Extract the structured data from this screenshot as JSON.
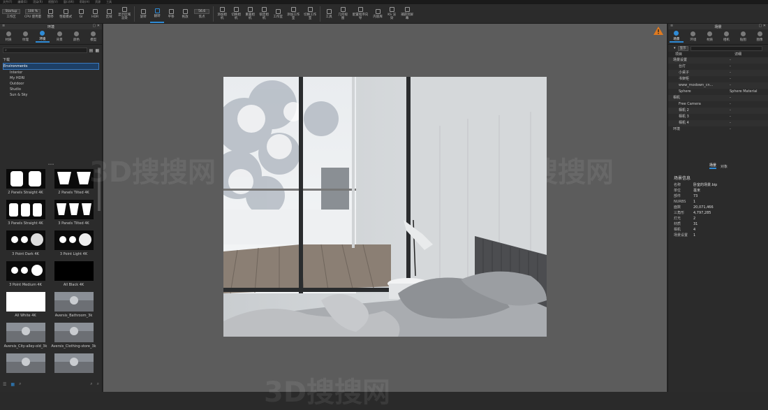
{
  "menu": [
    "文件(F)",
    "编辑(E)",
    "渲染(R)",
    "视图(V)",
    "窗口(W)",
    "帮助(H)",
    "资源",
    "工具"
  ],
  "toolbar": {
    "workspace_select": "Startup",
    "quality_value": "100 %",
    "cpu_label": "CPU 使用量",
    "pause_label": "暂停",
    "perf_label": "性能模式",
    "gi_label": "GI",
    "hdr_label": "HDR",
    "region_label": "区域",
    "region_render_label": "显示区域渲染",
    "rotate_label": "旋转",
    "translate_label": "平移",
    "rotate_view_label": "翻转",
    "drag_label": "拖放",
    "fov_value": "56.6",
    "focus_label": "焦点",
    "add_camera_label": "添加相机",
    "switch_camera_label": "切换相机",
    "reset_camera_label": "重置相机",
    "lock_camera_label": "锁定相机",
    "studio_label": "工作室",
    "add_studio_label": "添加工作室",
    "switch_studio_label": "切换工作室",
    "tools_label": "工具",
    "geometry_label": "几何视图",
    "configurator_label": "配置程序向导",
    "content_label": "内容库",
    "ks_label": "KS 渲染",
    "screenshot_label": "捕获到屏幕"
  },
  "left_panel": {
    "title": "环境",
    "tabs": [
      {
        "label": "材质",
        "icon": "material-icon"
      },
      {
        "label": "纹理",
        "icon": "texture-icon"
      },
      {
        "label": "环境",
        "icon": "environment-icon"
      },
      {
        "label": "背景",
        "icon": "backplate-icon"
      },
      {
        "label": "颜色",
        "icon": "color-icon"
      },
      {
        "label": "模型",
        "icon": "model-icon"
      }
    ],
    "search_placeholder": "",
    "tree": {
      "root": "下载",
      "selected": "Environments",
      "children": [
        "Interior",
        "My HDRI",
        "Outdoor",
        "Studio",
        "Sun & Sky"
      ]
    },
    "thumbnails": [
      {
        "label": "2 Panels Straight 4K",
        "kind": "panels-straight"
      },
      {
        "label": "2 Panels Tilted 4K",
        "kind": "panels-tilted"
      },
      {
        "label": "3 Panels Straight 4K",
        "kind": "panels3-straight"
      },
      {
        "label": "3 Panels Tilted 4K",
        "kind": "panels3-tilted"
      },
      {
        "label": "3 Point Dark 4K",
        "kind": "point-dark"
      },
      {
        "label": "3 Point Light 4K",
        "kind": "point-light"
      },
      {
        "label": "3 Point Medium 4K",
        "kind": "point-medium"
      },
      {
        "label": "All Black 4K",
        "kind": "black"
      },
      {
        "label": "All White 4K",
        "kind": "white"
      },
      {
        "label": "Aversis_Bathroom_3k",
        "kind": "photo"
      },
      {
        "label": "Aversis_City-alley-old_3k",
        "kind": "photo"
      },
      {
        "label": "Aversis_Clothing-store_3k",
        "kind": "photo"
      },
      {
        "label": "",
        "kind": "photo"
      },
      {
        "label": "",
        "kind": "photo"
      }
    ]
  },
  "right_panel": {
    "title": "场景",
    "tabs": [
      "场景",
      "环境",
      "材质",
      "相机",
      "贴图",
      "图像"
    ],
    "filter_label": "显示",
    "col_item": "项目",
    "col_detail": "详细",
    "rows": [
      {
        "name": "场景设置",
        "detail": "-"
      },
      {
        "name": "台灯",
        "detail": "-"
      },
      {
        "name": "小桌子",
        "detail": "-"
      },
      {
        "name": "书架柜",
        "detail": "-"
      },
      {
        "name": "www_modown_cn...",
        "detail": "-"
      },
      {
        "name": "Sphere",
        "detail": "Sphere Material"
      },
      {
        "name": "相机",
        "detail": "-"
      },
      {
        "name": "Free Camera",
        "detail": "-"
      },
      {
        "name": "相机 2",
        "detail": "-"
      },
      {
        "name": "相机 3",
        "detail": "-"
      },
      {
        "name": "相机 4",
        "detail": "-"
      },
      {
        "name": "环境",
        "detail": "-"
      }
    ],
    "bottom_tabs": [
      "场景",
      "对象"
    ],
    "info_title": "场景信息",
    "info": [
      {
        "k": "名称",
        "v": "卧室的场景.bip"
      },
      {
        "k": "单位",
        "v": "毫米"
      },
      {
        "k": "部件",
        "v": "73"
      },
      {
        "k": "NURBS",
        "v": "1"
      },
      {
        "k": "面数",
        "v": "20,071,466"
      },
      {
        "k": "三角形",
        "v": "4,797,285"
      },
      {
        "k": "灯光",
        "v": "2"
      },
      {
        "k": "材质",
        "v": "31"
      },
      {
        "k": "相机",
        "v": "4"
      },
      {
        "k": "场景设置",
        "v": "1"
      }
    ]
  },
  "viewport": {
    "warning_icon": "warning-icon"
  },
  "watermark": "3D搜搜网",
  "colors": {
    "accent": "#2f8bd6",
    "selection": "#1d3f66",
    "warning": "#e07a1f"
  }
}
